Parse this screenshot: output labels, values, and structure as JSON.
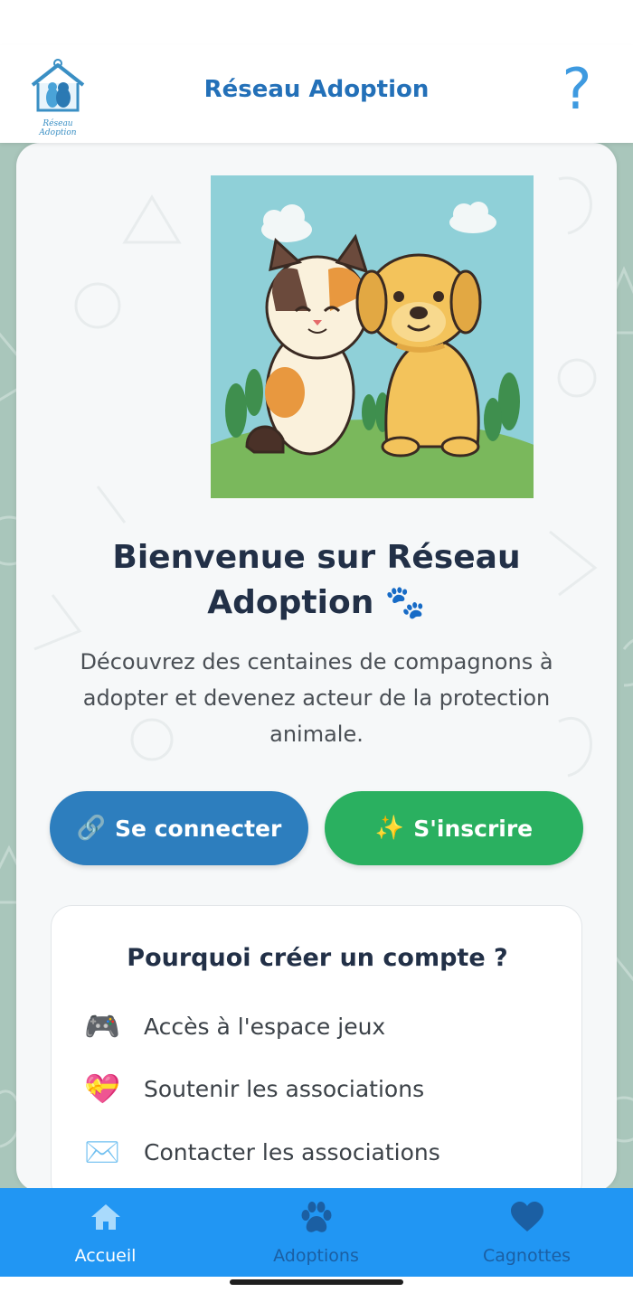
{
  "header": {
    "logo_text": "Réseau Adoption",
    "title": "Réseau Adoption",
    "help_label": "?"
  },
  "welcome": {
    "title": "Bienvenue sur Réseau Adoption 🐾",
    "description": "Découvrez des centaines de compagnons à adopter et devenez acteur de la protection animale."
  },
  "buttons": {
    "login_icon": "🔗",
    "login_label": "Se connecter",
    "signup_icon": "✨",
    "signup_label": "S'inscrire"
  },
  "why": {
    "title": "Pourquoi créer un compte ?",
    "items": [
      {
        "emoji": "🎮",
        "label": "Accès à l'espace jeux"
      },
      {
        "emoji": "💝",
        "label": "Soutenir les associations"
      },
      {
        "emoji": "✉️",
        "label": "Contacter les associations"
      }
    ]
  },
  "nav": {
    "items": [
      {
        "label": "Accueil",
        "icon": "home-icon",
        "active": true
      },
      {
        "label": "Adoptions",
        "icon": "paw-icon",
        "active": false
      },
      {
        "label": "Cagnottes",
        "icon": "heart-icon",
        "active": false
      }
    ]
  },
  "colors": {
    "accent": "#2196f3",
    "login": "#2d7ebe",
    "signup": "#2ab060",
    "title": "#223047"
  }
}
